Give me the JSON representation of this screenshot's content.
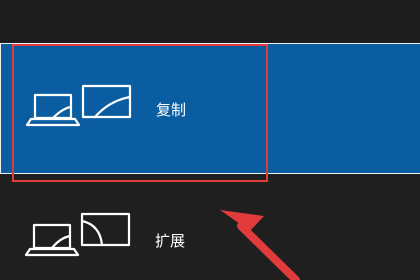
{
  "project_menu": {
    "options": [
      {
        "label": "复制",
        "icon": "duplicate-display-icon",
        "selected": true
      },
      {
        "label": "扩展",
        "icon": "extend-display-icon",
        "selected": false
      }
    ]
  },
  "annotation": {
    "highlight_color": "#e23b3b",
    "arrow_color": "#e23b3b"
  },
  "colors": {
    "selected_background": "#0b5da2",
    "menu_background": "#1f1f1f",
    "text": "#ffffff"
  }
}
